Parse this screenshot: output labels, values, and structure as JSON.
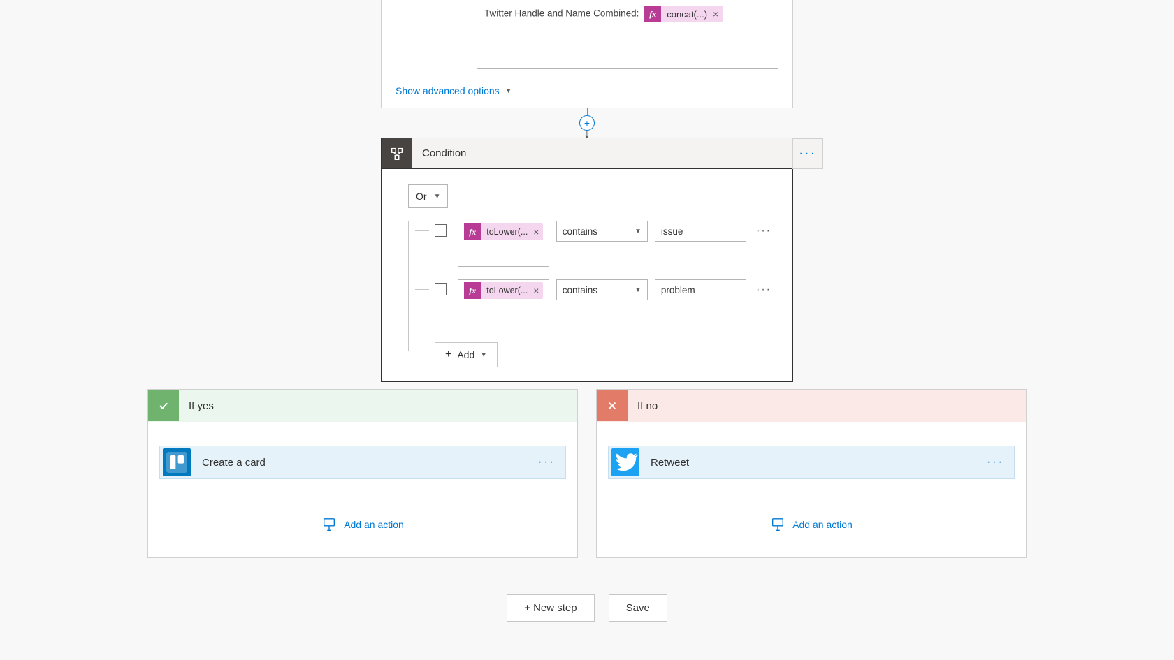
{
  "top": {
    "compose_label": "Twitter Handle and Name Combined:",
    "fx_expression": "concat(...)",
    "show_advanced": "Show advanced options"
  },
  "condition": {
    "title": "Condition",
    "group_operator": "Or",
    "rows": [
      {
        "expression": "toLower(...",
        "operator": "contains",
        "value": "issue"
      },
      {
        "expression": "toLower(...",
        "operator": "contains",
        "value": "problem"
      }
    ],
    "add_label": "Add"
  },
  "branches": {
    "yes": {
      "title": "If yes",
      "action": "Create a card",
      "add_action": "Add an action"
    },
    "no": {
      "title": "If no",
      "action": "Retweet",
      "add_action": "Add an action"
    }
  },
  "footer": {
    "new_step": "+ New step",
    "save": "Save"
  }
}
